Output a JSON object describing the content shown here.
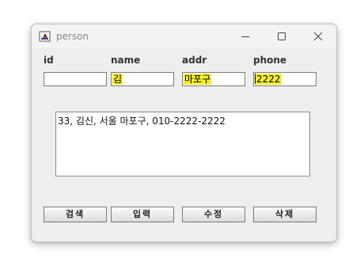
{
  "window": {
    "title": "person",
    "controls": {
      "minimize": "minimize",
      "maximize": "maximize",
      "close": "close"
    }
  },
  "form": {
    "labels": {
      "id": "id",
      "name": "name",
      "addr": "addr",
      "phone": "phone"
    },
    "values": {
      "id": "",
      "name": "김",
      "addr": "마포구",
      "phone": "2222"
    }
  },
  "result": {
    "text": "33, 김신, 서울 마포구, 010-2222-2222"
  },
  "buttons": {
    "search": "검색",
    "insert": "입력",
    "update": "수정",
    "delete": "삭제"
  },
  "colors": {
    "highlight": "#f6ee2a",
    "window_bg": "#eeeeee"
  }
}
